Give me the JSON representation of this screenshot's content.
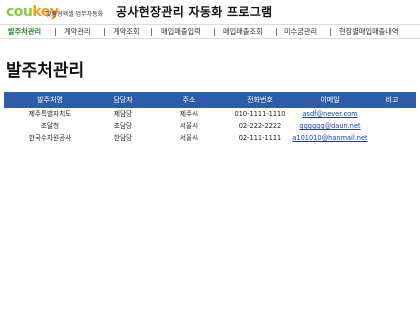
{
  "header": {
    "logo_part1": "cou",
    "logo_part2": "key",
    "logo_subtitle": "맞춤형엑셀 업무자동화",
    "app_title": "공사현장관리 자동화 프로그램"
  },
  "nav": {
    "items": [
      {
        "label": "발주처관리",
        "active": true
      },
      {
        "label": "계약관리",
        "active": false
      },
      {
        "label": "계약조회",
        "active": false
      },
      {
        "label": "매입매출입력",
        "active": false
      },
      {
        "label": "매입매출조회",
        "active": false
      },
      {
        "label": "미수금관리",
        "active": false
      },
      {
        "label": "현장별매입매출내역",
        "active": false
      }
    ]
  },
  "page": {
    "title": "발주처관리"
  },
  "table": {
    "headers": [
      "발주처명",
      "담당자",
      "주소",
      "전화번호",
      "이메일",
      "비고"
    ],
    "rows": [
      [
        "제주특별자치도",
        "제담당",
        "제주시",
        "010-1111-1110",
        "asdf@never.com",
        ""
      ],
      [
        "조달청",
        "조담당",
        "서울시",
        "02-222-2222",
        "gggggg@daun.net",
        ""
      ],
      [
        "한국수자원공사",
        "한담당",
        "서울시",
        "02-111-1111",
        "a101010@hanmail.net",
        ""
      ]
    ]
  },
  "colors": {
    "header_bar": "#2d5da8",
    "nav_active": "#2e7d32",
    "logo_green": "#8cc63f",
    "logo_orange": "#f39c12",
    "link": "#1a3fb0"
  }
}
